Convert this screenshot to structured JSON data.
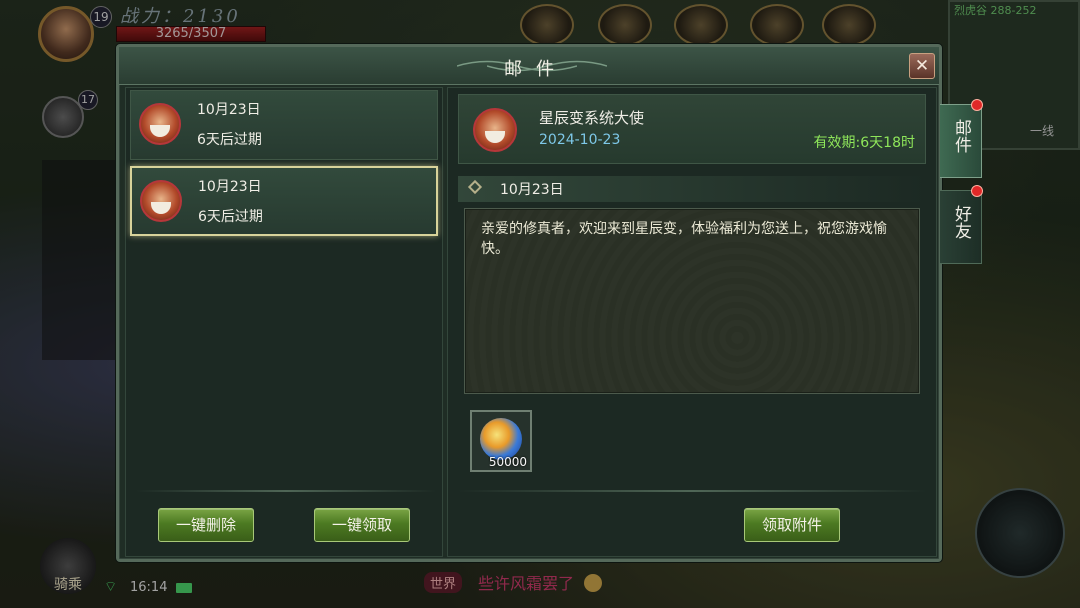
{
  "hud": {
    "level": "19",
    "power": "战力：2130",
    "hp": "3265/3507",
    "pet_level": "17",
    "minimap_title": "烈虎谷 288-252",
    "channel": "一线",
    "mount_label": "骑乘",
    "time": "16:14",
    "chat": {
      "channel": "世界",
      "message": "些许风霜罢了"
    }
  },
  "mail": {
    "title": "邮件",
    "close_glyph": "✕",
    "items": [
      {
        "date": "10月23日",
        "expire": "6天后过期",
        "selected": false
      },
      {
        "date": "10月23日",
        "expire": "6天后过期",
        "selected": true
      }
    ],
    "buttons": {
      "delete_all": "一键删除",
      "claim_all": "一键领取",
      "claim_attachment": "领取附件"
    },
    "detail": {
      "sender": "星辰变系统大使",
      "date": "2024-10-23",
      "validity": "有效期:6天18时",
      "subject": "10月23日",
      "body": "亲爱的修真者，欢迎来到星辰变，体验福利为您送上，祝您游戏愉快。",
      "attachment": {
        "icon": "spirit-orb-icon",
        "count": "50000"
      }
    }
  },
  "side_tabs": [
    {
      "label": "邮件",
      "active": true
    },
    {
      "label": "好友",
      "active": false
    }
  ],
  "colors": {
    "validity": "#8ee65a",
    "date": "#7ec8e8",
    "button_green": "#4c7a22",
    "notification": "#e02828"
  }
}
